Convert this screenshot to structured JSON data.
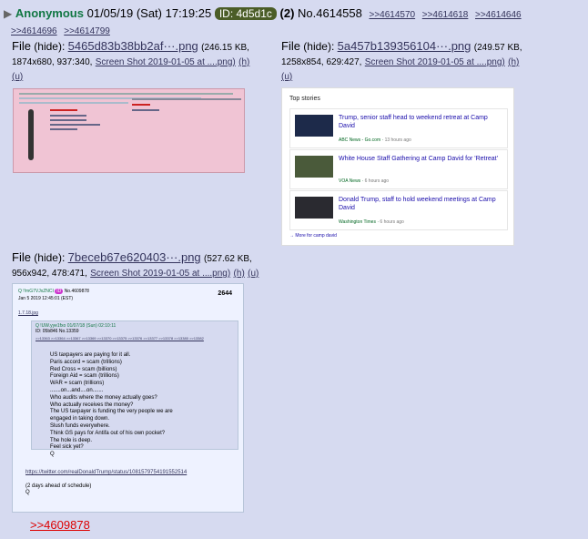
{
  "post": {
    "name": "Anonymous",
    "date": "01/05/19 (Sat) 17:19:25",
    "id": "ID: 4d5d1c",
    "count": "(2)",
    "number": "No.4614558",
    "backlinks": [
      ">>4614570",
      ">>4614618",
      ">>4614646",
      ">>4614696",
      ">>4614799"
    ]
  },
  "files": [
    {
      "label": "File",
      "hide": "(hide):",
      "filename": "5465d83b38bb2af···.png",
      "size": "(246.15 KB,",
      "dims": "1874x680, 937:340,",
      "orig": "Screen Shot 2019-01-05 at ....png)",
      "h": "(h)",
      "u": "(u)"
    },
    {
      "label": "File",
      "hide": "(hide):",
      "filename": "5a457b139356104···.png",
      "size": "(249.57 KB,",
      "dims": "1258x854, 629:427,",
      "orig": "Screen Shot 2019-01-05 at ....png)",
      "h": "(h)",
      "u": "(u)"
    },
    {
      "label": "File",
      "hide": "(hide):",
      "filename": "7beceb67e620403···.png",
      "size": "(527.62 KB,",
      "dims": "956x942, 478:471,",
      "orig": "Screen Shot 2019-01-05 at ....png)",
      "h": "(h)",
      "u": "(u)"
    }
  ],
  "thumb2": {
    "title": "Top stories",
    "stories": [
      {
        "title": "Trump, senior staff head to weekend retreat at Camp David",
        "source": "ABC News - Go.com",
        "time": "13 hours ago"
      },
      {
        "title": "White House Staff Gathering at Camp David for 'Retreat'",
        "source": "VOA News",
        "time": "6 hours ago"
      },
      {
        "title": "Donald Trump, staff to hold weekend meetings at Camp David",
        "source": "Washington Times",
        "time": "6 hours ago"
      }
    ],
    "more": "More for camp david"
  },
  "thumb3": {
    "header": "Q !!mG7VJxZNCI",
    "number": "No.4609878",
    "post_no": "2644",
    "date": "Jan 5 2019 12:45:01 (EST)",
    "file": "1.7.18.jpg",
    "inner_header": "Q !UW.yye1fxo  01/07/18 (Sun) 02:10:11",
    "inner_id": "ID: 05b846 No.13359",
    "inner_backlinks": ">>13363 >>13364 >>13367 >>13369 >>13370 >>13375 >>13376 >>13377 >>13378 >>13380 >>13382",
    "body": [
      "US taxpayers are paying for it all.",
      "Paris accord = scam (trillions)",
      "Red Cross = scam (billions)",
      "Foreign Aid = scam (trillions)",
      "WAR = scam (trillions)",
      ".......on...and....on.......",
      "Who audits where the money actually goes?",
      "Who actually receives the money?",
      "The US taxpayer is funding the very people we are",
      "engaged in taking down.",
      "Slush funds everywhere.",
      "Think GS pays for Antifa out of his own pocket?",
      "The hole is deep.",
      "Feel sick yet?",
      "Q"
    ],
    "link": "https://twitter.com/realDonaldTrump/status/1081579754191552514",
    "footer1": "(2 days ahead of schedule)",
    "footer2": "Q"
  },
  "bottom_link": ">>4609878"
}
